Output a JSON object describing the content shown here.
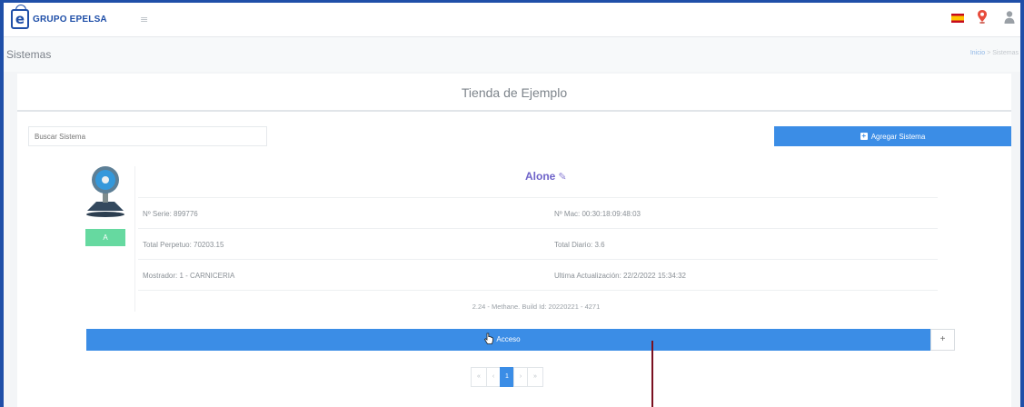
{
  "brand": {
    "logo_letter": "e",
    "name": "GRUPO EPELSA"
  },
  "header": {
    "menu_icon": "hamburger-icon",
    "icons": [
      "spain-flag-icon",
      "location-pin-icon",
      "user-icon"
    ]
  },
  "breadcrumb": {
    "page_title": "Sistemas",
    "home": "Inicio",
    "separator": ">",
    "current": "Sistemas"
  },
  "store": {
    "title": "Tienda de Ejemplo"
  },
  "search": {
    "placeholder": "Buscar Sistema"
  },
  "toolbar": {
    "add_label": "Agregar Sistema"
  },
  "system": {
    "name": "Alone",
    "status": "A",
    "serial": "Nº Serie: 899776",
    "mac": "Nº Mac: 00:30:18:09:48:03",
    "total_perpetual": "Total Perpetuo: 70203.15",
    "total_daily": "Total Diario: 3.6",
    "counter": "Mostrador: 1 - CARNICERIA",
    "last_update": "Ultima Actualización: 22/2/2022 15:34:32",
    "build": "2.24 - Methane. Build Id: 20220221 - 4271"
  },
  "access": {
    "label": "Acceso",
    "more_label": "+"
  },
  "pagination": {
    "first": "«",
    "prev": "‹",
    "current": "1",
    "next": "›",
    "last": "»"
  },
  "colors": {
    "brand_blue": "#1f4fa8",
    "button_blue": "#3b8de6",
    "status_green": "#66d9a0",
    "name_purple": "#6e63c9"
  }
}
